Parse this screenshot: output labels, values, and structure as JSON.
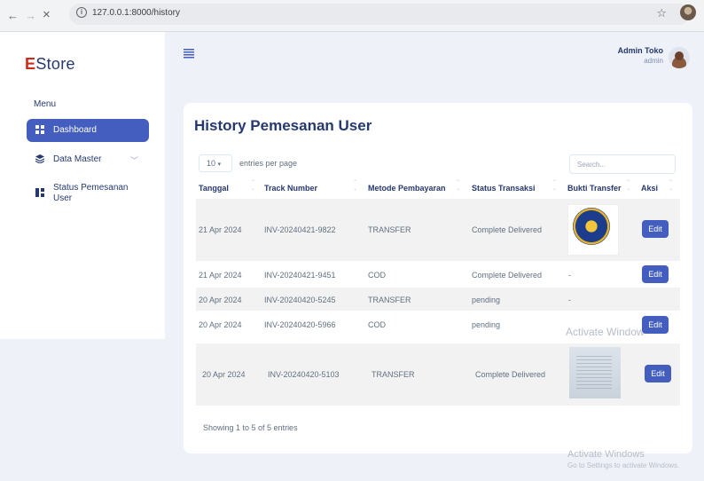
{
  "browser": {
    "url": "127.0.0.1:8000/history",
    "back_icon": "←",
    "forward_icon": "→",
    "stop_icon": "×",
    "star_icon": "☆"
  },
  "sidebar": {
    "logo_first": "E",
    "logo_rest": "Store",
    "menu_title": "Menu",
    "items": [
      {
        "label": "Dashboard",
        "icon": "grid-icon"
      },
      {
        "label": "Data Master",
        "icon": "stack-icon"
      },
      {
        "label": "Status Pemesanan User",
        "icon": "layout-icon"
      }
    ]
  },
  "header": {
    "user_name": "Admin Toko",
    "user_role": "admin"
  },
  "page": {
    "title": "History Pemesanan User"
  },
  "table_controls": {
    "per_page_value": "10",
    "per_page_suffix": "entries per page",
    "search_placeholder": "Search..."
  },
  "table": {
    "columns": [
      "Tanggal",
      "Track Number",
      "Metode Pembayaran",
      "Status Transaksi",
      "Bukti Transfer",
      "Aksi"
    ],
    "rows": [
      {
        "tanggal": "21 Apr 2024",
        "track": "INV-20240421-9822",
        "metode": "TRANSFER",
        "status": "Complete Delivered",
        "bukti": "image-logo",
        "aksi": "Edit"
      },
      {
        "tanggal": "21 Apr 2024",
        "track": "INV-20240421-9451",
        "metode": "COD",
        "status": "Complete Delivered",
        "bukti": "-",
        "aksi": "Edit"
      },
      {
        "tanggal": "20 Apr 2024",
        "track": "INV-20240420-5245",
        "metode": "TRANSFER",
        "status": "pending",
        "bukti": "-",
        "aksi": ""
      },
      {
        "tanggal": "20 Apr 2024",
        "track": "INV-20240420-5966",
        "metode": "COD",
        "status": "pending",
        "bukti": "",
        "aksi": "Edit"
      },
      {
        "tanggal": "20 Apr 2024",
        "track": "INV-20240420-5103",
        "metode": "TRANSFER",
        "status": "Complete Delivered",
        "bukti": "image-document",
        "aksi": "Edit"
      }
    ]
  },
  "footer": {
    "info": "Showing 1 to 5 of 5 entries"
  },
  "watermark": {
    "overlay": "Activate Window",
    "title": "Activate Windows",
    "subtitle": "Go to Settings to activate Windows."
  }
}
